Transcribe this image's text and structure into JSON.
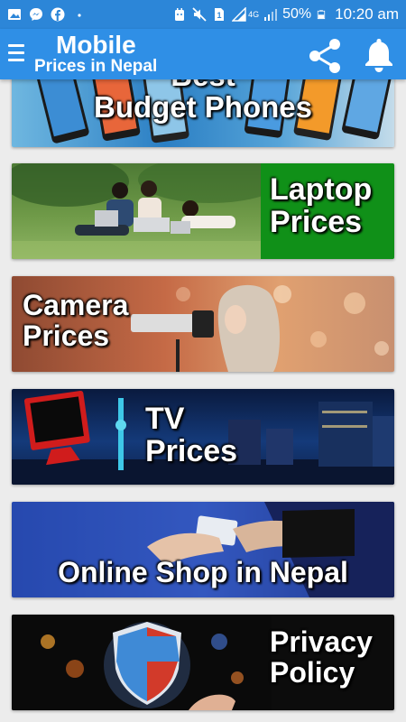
{
  "status_bar": {
    "battery": "50%",
    "time": "10:20 am",
    "network": "4G",
    "sim": "1",
    "left_icons": [
      "gallery-icon",
      "messenger-icon",
      "facebook-icon",
      "dot-icon"
    ],
    "right_icons": [
      "android-debug-icon",
      "mute-icon",
      "sim-icon",
      "signal-icon",
      "battery-icon"
    ]
  },
  "app_bar": {
    "title_line1": "Mobile",
    "title_line2": "Prices in Nepal",
    "menu_icon": "hamburger-menu-icon",
    "share_icon": "share-icon",
    "notification_icon": "bell-icon"
  },
  "cards": [
    {
      "id": "budget-phones",
      "line1": "Best",
      "line2": "Budget Phones",
      "label_bg": "#4aa0d8"
    },
    {
      "id": "laptop-prices",
      "line1": "Laptop",
      "line2": "Prices",
      "label_bg": "#109018"
    },
    {
      "id": "camera-prices",
      "line1": "Camera",
      "line2": "Prices",
      "label_bg": "#b05a3c"
    },
    {
      "id": "tv-prices",
      "line1": "TV",
      "line2": "Prices",
      "label_bg": "#0f1e3c"
    },
    {
      "id": "online-shop",
      "line1": "Online Shop in Nepal",
      "label_bg": "#1c3e9c"
    },
    {
      "id": "privacy-policy",
      "line1": "Privacy",
      "line2": "Policy",
      "label_bg": "#101010"
    }
  ],
  "colors": {
    "status_bar": "#2c86d8",
    "app_bar": "#2f8fe6",
    "background": "#ececec"
  }
}
